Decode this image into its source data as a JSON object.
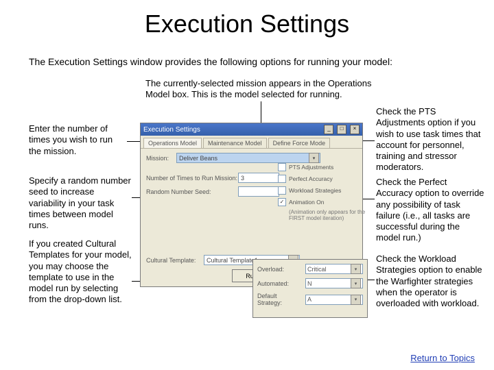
{
  "title": "Execution Settings",
  "subtitle": "The Execution Settings window provides the following options for running your model:",
  "ann": {
    "top_note": "The currently-selected mission appears in the Operations Model box.  This is the model selected for running.",
    "left1": "Enter the number of times you wish to run the mission.",
    "left2": "Specify a random number seed to increase variability in your task times between model runs.",
    "left3": "If you created Cultural Templates for your model, you may choose the template to use in the model run by selecting from the drop-down list.",
    "right1": "Check the PTS Adjustments option if you wish to use task times that account for personnel, training and stressor moderators.",
    "right2": "Check the Perfect Accuracy option to override any possibility of task failure (i.e., all tasks are successful during the model run.)",
    "right3": "Check the Workload Strategies option to enable the Warfighter strategies when the operator is overloaded with workload."
  },
  "win": {
    "title": "Execution Settings",
    "tabs": [
      "Operations Model",
      "Maintenance Model",
      "Define Force Mode"
    ],
    "mission_label": "Mission:",
    "mission_value": "Deliver Beans",
    "num_times_label": "Number of Times to Run Mission:",
    "num_times_value": "3",
    "seed_label": "Random Number Seed:",
    "cultural_label": "Cultural Template:",
    "cultural_value": "Cultural Template1",
    "run_btn": "Run",
    "chk": {
      "pts": "PTS Adjustments",
      "perfect": "Perfect Accuracy",
      "workload": "Workload Strategies",
      "anim": "Animation On",
      "anim_hint": "(Animation only appears for the FIRST model iteration)"
    }
  },
  "inset": {
    "overload_label": "Overload:",
    "overload_value": "Critical",
    "automated_label": "Automated:",
    "automated_value": "N",
    "default_label": "Default Strategy:",
    "default_value": "A"
  },
  "link": "Return to Topics"
}
